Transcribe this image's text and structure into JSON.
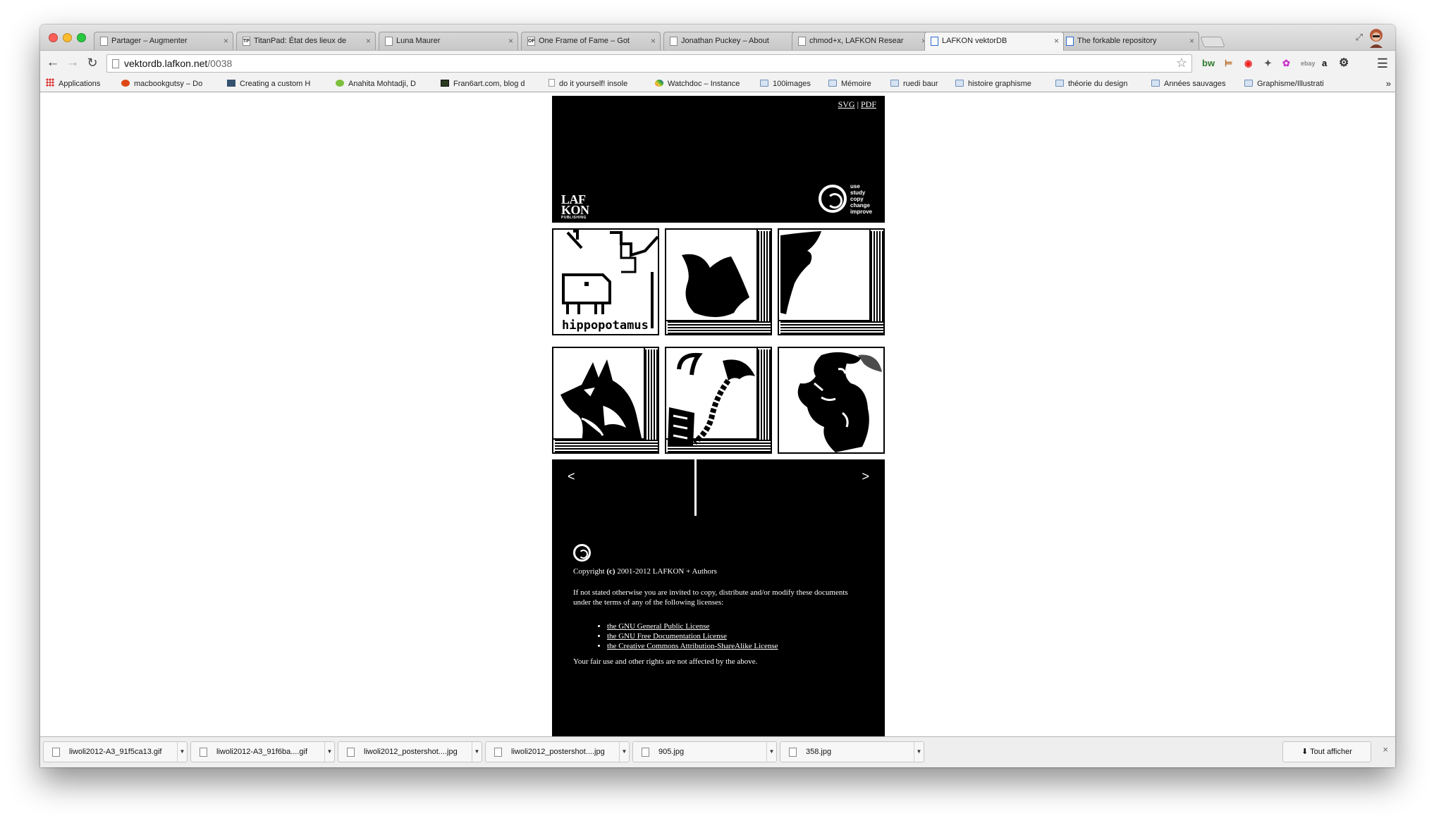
{
  "tabs": [
    {
      "title": "Partager – Augmenter",
      "favicon": "page"
    },
    {
      "title": "TitanPad: État des lieux de",
      "favicon": "TP"
    },
    {
      "title": "Luna Maurer",
      "favicon": "page"
    },
    {
      "title": "One Frame of Fame – Got",
      "favicon": "OF"
    },
    {
      "title": "Jonathan Puckey – About",
      "favicon": "page"
    },
    {
      "title": "chmod+x, LAFKON Resear",
      "favicon": "page"
    },
    {
      "title": "LAFKON vektorDB",
      "favicon": "lafkon",
      "active": true
    },
    {
      "title": "The forkable repository",
      "favicon": "lafkon"
    }
  ],
  "toolbar": {
    "url_host": "vektordb.lafkon.net",
    "url_path": "/0038",
    "extensions": [
      "bw",
      "ext-bars",
      "ext-red",
      "ext-evernote",
      "ext-color",
      "ebay",
      "a"
    ]
  },
  "bookmarks": [
    {
      "label": "Applications",
      "icon": "apps"
    },
    {
      "label": "macbookgutsy – Do",
      "icon": "ubuntu"
    },
    {
      "label": "Creating a custom H",
      "icon": "tumblr"
    },
    {
      "label": "Anahita Mohtadji, D",
      "icon": "green"
    },
    {
      "label": "Fran6art.com, blog d",
      "icon": "frame"
    },
    {
      "label": "do it yourself! insole",
      "icon": "page"
    },
    {
      "label": "Watchdoc – Instance",
      "icon": "wd"
    },
    {
      "label": "100images",
      "icon": "folder"
    },
    {
      "label": "Mémoire",
      "icon": "folder"
    },
    {
      "label": "ruedi baur",
      "icon": "folder"
    },
    {
      "label": "histoire graphisme",
      "icon": "folder"
    },
    {
      "label": "théorie du design",
      "icon": "folder"
    },
    {
      "label": "Années sauvages",
      "icon": "folder"
    },
    {
      "label": "Graphisme/Illustrati",
      "icon": "folder"
    }
  ],
  "bookmarks_more": "»",
  "site": {
    "header_links": [
      "SVG",
      "PDF"
    ],
    "header_sep": "|",
    "logo_lines": [
      "LAF",
      "KON"
    ],
    "logo_sub": "PUBLISHING",
    "motto": [
      "use",
      "study",
      "copy",
      "change",
      "improve"
    ],
    "thumbs": [
      {
        "caption": "hippopotamus"
      },
      {
        "caption": ""
      },
      {
        "caption": ""
      },
      {
        "caption": ""
      },
      {
        "caption": ""
      },
      {
        "caption": ""
      }
    ],
    "pager_prev": "<",
    "pager_next": ">",
    "footer": {
      "copyright_prefix": "Copyright",
      "copyright_c": "(c)",
      "copyright_rest": "2001-2012 LAFKON + Authors",
      "intro": "If not stated otherwise you are invited to copy, distribute and/or modify these documents under the terms of any of the following licenses:",
      "licenses": [
        "the GNU General Public License",
        "the GNU Free Documentation License",
        "the Creative Commons Attribution-ShareAlike License"
      ],
      "rights": "Your fair use and other rights are not affected by the above."
    }
  },
  "downloads": [
    "liwoli2012-A3_91f5ca13.gif",
    "liwoli2012-A3_91f6ba....gif",
    "liwoli2012_postershot....jpg",
    "liwoli2012_postershot....jpg",
    "905.jpg",
    "358.jpg"
  ],
  "show_all_label": "Tout afficher"
}
